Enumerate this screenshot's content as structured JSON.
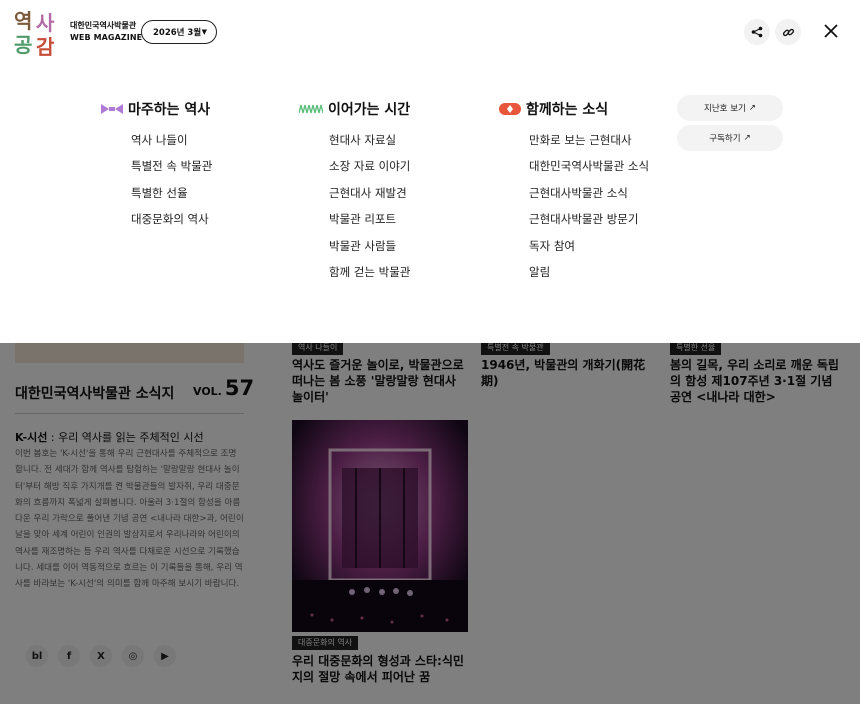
{
  "brand": {
    "name_ko": "대한민국역사박물관",
    "name_en": "WEB MAGAZINE",
    "logo_text": "역사공감"
  },
  "issue_select": {
    "value": "2026년 3월"
  },
  "toolbar": {
    "share_icon": "share-icon",
    "link_icon": "link-icon",
    "close_icon": "close-icon"
  },
  "menu": {
    "categories": [
      {
        "title": "마주하는 역사",
        "color": "#b07ad9",
        "items": [
          "역사 나들이",
          "특별전 속 박물관",
          "특별한 선율",
          "대중문화의 역사"
        ]
      },
      {
        "title": "이어가는 시간",
        "color": "#5cbf7a",
        "items": [
          "현대사 자료실",
          "소장 자료 이야기",
          "근현대사 재발견",
          "박물관 리포트",
          "박물관 사람들",
          "함께 걷는 박물관"
        ]
      },
      {
        "title": "함께하는 소식",
        "color": "#e8573c",
        "items": [
          "만화로 보는 근현대사",
          "대한민국역사박물관 소식",
          "근현대사박물관 소식",
          "근현대사박물관 방문기",
          "독자 참여",
          "알림"
        ]
      }
    ],
    "links": [
      {
        "label": "지난호 보기",
        "arrow": "↗"
      },
      {
        "label": "구독하기",
        "arrow": "↗"
      }
    ]
  },
  "background": {
    "magazine_title": "대한민국역사박물관 소식지",
    "vol_label": "VOL.",
    "vol_number": "57",
    "k_sub_bold": "K-시선",
    "k_sub_rest": " : 우리 역사를 읽는 주체적인 시선",
    "k_desc": "이번 봄호는 'K-시선'을 통해 우리 근현대사를 주체적으로 조명합니다. 전 세대가 함께 역사를 탐험하는 '말랑말랑 현대사 놀이터'부터 해방 직후 가지개를 켠 박물관들의 발자취, 우리 대중문화의 흐름까지 폭넓게 살펴봅니다. 아울러 3·1절의 함성을 아름다운 우리 가락으로 풀어낸 기념 공연 <내나라 대한>과, 어린이날을 맞아 세계 어린이 인권의 발상지로서 우리나라와 어린이의 역사를 재조명하는 등 우리 역사를 다채로운 시선으로 기록했습니다. 세대를 이어 역동적으로 흐르는 이 기록들을 통해, 우리 역사를 바라보는 'K-시선'의 의미를 함께 마주해 보시기 바랍니다.",
    "social": [
      "bl",
      "f",
      "X",
      "◎",
      "▶"
    ],
    "articles": [
      {
        "tag": "역사 나들이",
        "title": "역사도 즐거운 놀이로, 박물관으로 떠나는 봄 소풍 '말랑말랑 현대사 놀이터'"
      },
      {
        "tag": "특별전 속 박물관",
        "title": "1946년, 박물관의 개화기(開花期)"
      },
      {
        "tag": "특별한 선율",
        "title": "봄의 길목, 우리 소리로 깨운 독립의 함성 제107주년 3·1절 기념 공연 <내나라 대한>"
      },
      {
        "tag": "대중문화의 역사",
        "title": "우리 대중문화의 형성과 스타:식민지의 절망 속에서 피어난 꿈"
      }
    ]
  }
}
